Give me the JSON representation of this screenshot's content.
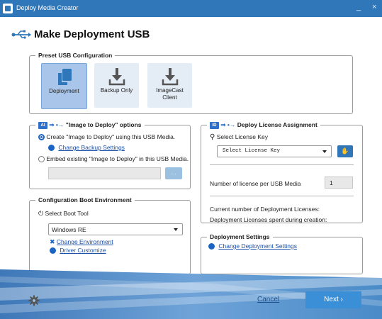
{
  "window": {
    "title": "Deploy Media Creator",
    "minimize": "_",
    "close": "×"
  },
  "header": {
    "title": "Make Deployment USB",
    "icon": "usb-icon"
  },
  "preset": {
    "legend": "Preset USB Configuration",
    "tiles": [
      {
        "label": "Deployment",
        "selected": true,
        "icon": "deployment-icon"
      },
      {
        "label": "Backup Only",
        "selected": false,
        "icon": "download-icon"
      },
      {
        "label_line1": "ImageCast",
        "label_line2": "Client",
        "selected": false,
        "icon": "download-icon"
      }
    ]
  },
  "image_options": {
    "legend_badge": "AI",
    "legend": "\"Image to Deploy\" options",
    "create_label": "Create \"Image to Deploy\" using this USB Media.",
    "change_backup_link": "Change Backup Settings",
    "embed_label": "Embed existing \"Image to Deploy\" in this USB Media.",
    "browse_label": "..."
  },
  "license": {
    "legend_badge": "ID",
    "legend": "Deploy License Assignment",
    "select_label": "Select License Key",
    "select_value": "Select License Key",
    "per_media_label": "Number of license per USB Media",
    "per_media_value": "1",
    "current_label": "Current number of Deployment Licenses:",
    "spent_label": "Deployment Licenses spent during creation:"
  },
  "boot": {
    "legend": "Configuration Boot Environment",
    "select_tool_label": "Select Boot Tool",
    "tool_value": "Windows RE",
    "change_env_link": "Change Environment",
    "driver_link": "Driver Customize"
  },
  "deploy_settings": {
    "legend": "Deployment Settings",
    "link": "Change Deployment Settings"
  },
  "footer": {
    "cancel": "Cancel",
    "next": "Next ›"
  },
  "colors": {
    "titlebar": "#2f77b8",
    "accent": "#1c64c4",
    "selected_tile": "#a9c6ea",
    "tile": "#e4ecf5",
    "next_button": "#3b8fd6"
  }
}
